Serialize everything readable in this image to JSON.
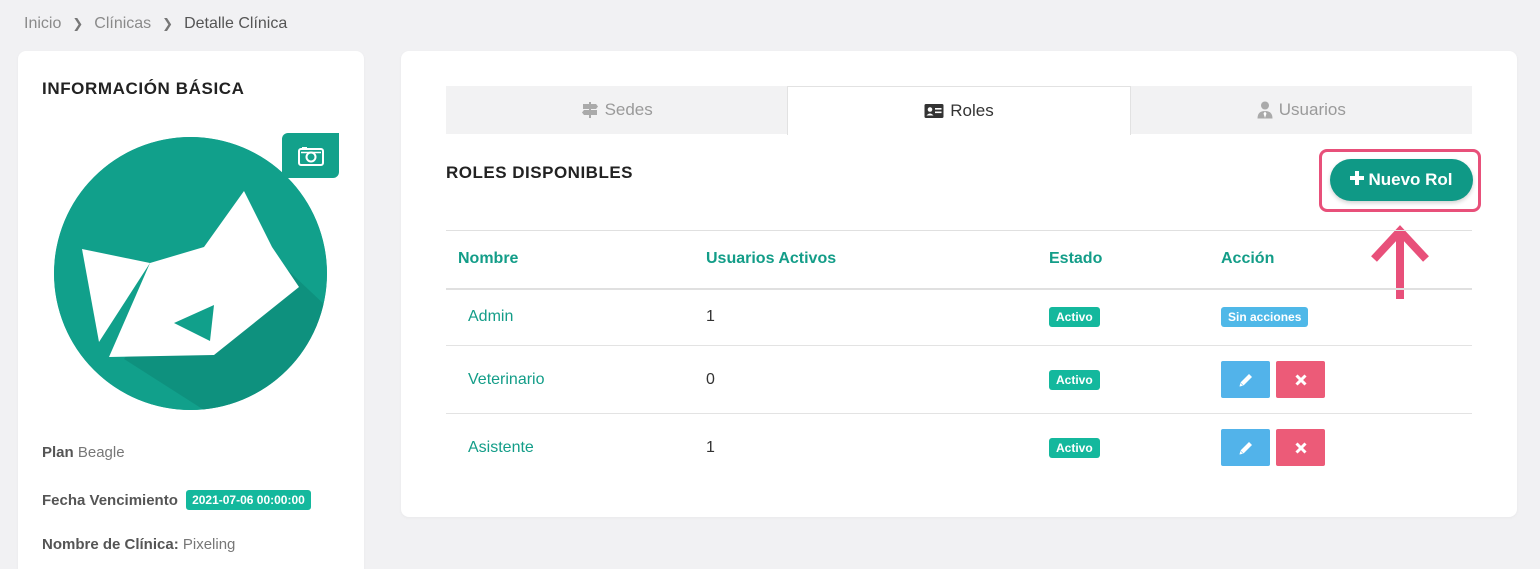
{
  "breadcrumb": {
    "items": [
      "Inicio",
      "Clínicas",
      "Detalle Clínica"
    ]
  },
  "basic_info": {
    "title": "INFORMACIÓN BÁSICA",
    "plan_label": "Plan",
    "plan_value": "Beagle",
    "expiry_label": "Fecha Vencimiento",
    "expiry_value": "2021-07-06 00:00:00",
    "clinic_name_label": "Nombre de Clínica:",
    "clinic_name_value": "Pixeling",
    "camera_icon": "camera-icon"
  },
  "tabs": [
    {
      "label": "Sedes",
      "icon": "signpost-icon",
      "active": false
    },
    {
      "label": "Roles",
      "icon": "id-card-icon",
      "active": true
    },
    {
      "label": "Usuarios",
      "icon": "user-tie-icon",
      "active": false
    }
  ],
  "roles_section": {
    "title": "ROLES DISPONIBLES",
    "new_button_label": "Nuevo Rol",
    "columns": [
      "Nombre",
      "Usuarios Activos",
      "Estado",
      "Acción"
    ],
    "rows": [
      {
        "name": "Admin",
        "active_users": "1",
        "status": "Activo",
        "action": "Sin acciones"
      },
      {
        "name": "Veterinario",
        "active_users": "0",
        "status": "Activo",
        "action": "buttons"
      },
      {
        "name": "Asistente",
        "active_users": "1",
        "status": "Activo",
        "action": "buttons"
      }
    ]
  },
  "colors": {
    "brand": "#0f9986",
    "badge": "#14b89d",
    "highlight": "#e8507a",
    "edit": "#52b3ea",
    "delete": "#ec5b78"
  }
}
